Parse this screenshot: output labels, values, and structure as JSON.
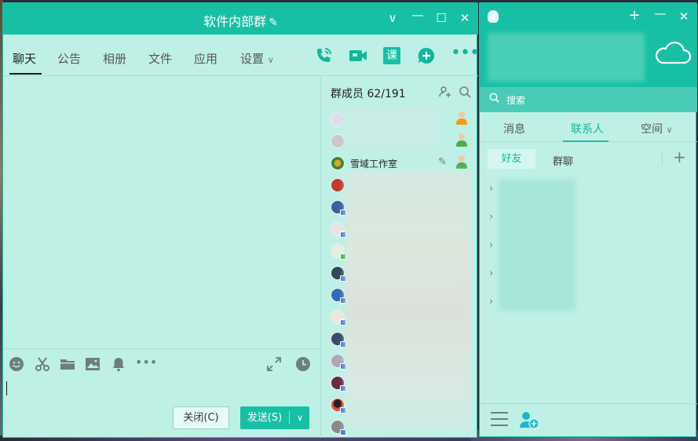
{
  "group_window": {
    "title": "软件内部群",
    "title_icon": "pencil-icon",
    "window_controls": [
      "chevron-down-icon",
      "minimize-icon",
      "maximize-icon",
      "close-icon"
    ],
    "tabs": [
      {
        "label": "聊天",
        "active": true
      },
      {
        "label": "公告"
      },
      {
        "label": "相册"
      },
      {
        "label": "文件"
      },
      {
        "label": "应用"
      },
      {
        "label": "设置"
      }
    ],
    "actions": [
      "phone-icon",
      "video-icon",
      "lesson-icon",
      "add-app-icon",
      "more-icon"
    ],
    "lesson_label": "课",
    "toolbar": [
      "emoji-icon",
      "scissors-icon",
      "folder-icon",
      "image-icon",
      "bell-icon",
      "more-icon",
      "expand-icon",
      "history-icon"
    ],
    "close_button": "关闭(C)",
    "send_button": "发送(S)",
    "members": {
      "title": "群成员 62/191",
      "highlight_member": "雪域工作室",
      "accent": "#17c0a5"
    }
  },
  "contacts_window": {
    "search_placeholder": "搜索",
    "tabs": [
      {
        "label": "消息"
      },
      {
        "label": "联系人",
        "active": true
      },
      {
        "label": "空间"
      }
    ],
    "subtabs": [
      {
        "label": "好友",
        "active": true
      },
      {
        "label": "群聊"
      }
    ]
  }
}
